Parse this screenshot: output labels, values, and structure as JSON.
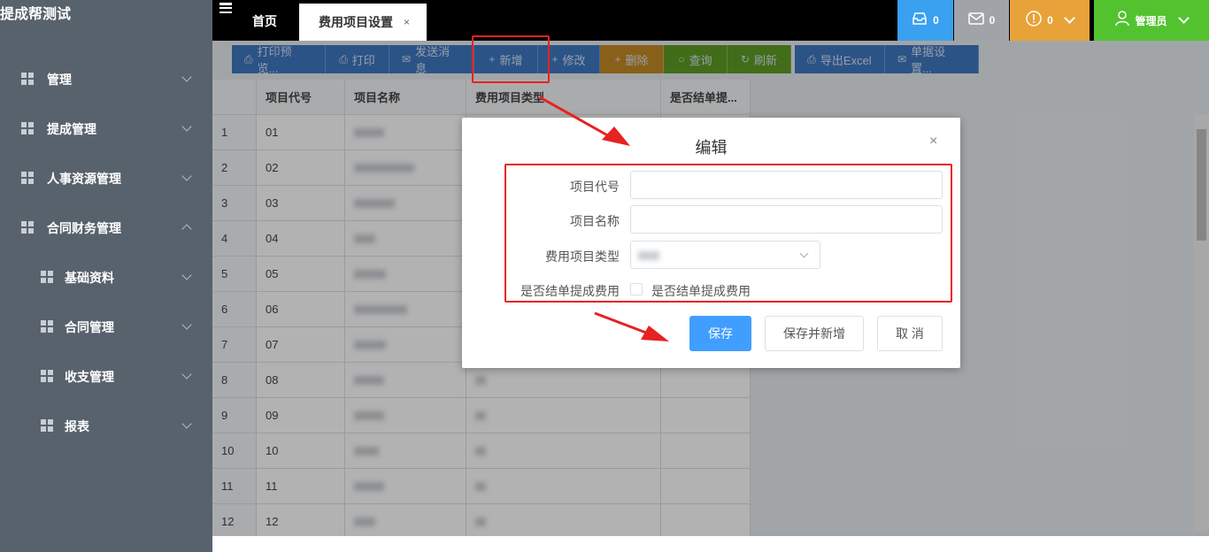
{
  "app": {
    "title": "提成帮测试"
  },
  "sidebar": {
    "items": [
      {
        "label": "管理",
        "expanded": false,
        "level": 0
      },
      {
        "label": "提成管理",
        "expanded": false,
        "level": 0
      },
      {
        "label": "人事资源管理",
        "expanded": false,
        "level": 0
      },
      {
        "label": "合同财务管理",
        "expanded": true,
        "level": 0
      },
      {
        "label": "基础资料",
        "expanded": false,
        "level": 1
      },
      {
        "label": "合同管理",
        "expanded": false,
        "level": 1
      },
      {
        "label": "收支管理",
        "expanded": false,
        "level": 1
      },
      {
        "label": "报表",
        "expanded": false,
        "level": 1
      }
    ]
  },
  "topbar": {
    "tabs": {
      "home": "首页",
      "active": "费用项目设置",
      "close": "×"
    },
    "inbox_count": "0",
    "mail_count": "0",
    "alert_count": "0",
    "user_label": "管理员",
    "colors": {
      "inbox": "#3aa0f0",
      "mail": "#a0a4a9",
      "alert": "#e8a23a",
      "user": "#52c32f"
    }
  },
  "toolbar": {
    "print_preview": "打印预览...",
    "print": "打印",
    "send_message": "发送消息",
    "add": "新增",
    "modify": "修改",
    "delete": "删除",
    "query": "查询",
    "refresh": "刷新",
    "export_excel": "导出Excel",
    "doc_settings": "单据设置..."
  },
  "table": {
    "columns": [
      "",
      "项目代号",
      "项目名称",
      "费用项目类型",
      "是否结单提..."
    ],
    "rows": [
      {
        "index": "1",
        "code": "01"
      },
      {
        "index": "2",
        "code": "02"
      },
      {
        "index": "3",
        "code": "03"
      },
      {
        "index": "4",
        "code": "04"
      },
      {
        "index": "5",
        "code": "05"
      },
      {
        "index": "6",
        "code": "06"
      },
      {
        "index": "7",
        "code": "07"
      },
      {
        "index": "8",
        "code": "08"
      },
      {
        "index": "9",
        "code": "09"
      },
      {
        "index": "10",
        "code": "10"
      },
      {
        "index": "11",
        "code": "11"
      },
      {
        "index": "12",
        "code": "12"
      }
    ]
  },
  "dialog": {
    "title": "编辑",
    "close": "×",
    "fields": {
      "code_label": "项目代号",
      "code_value": "",
      "name_label": "项目名称",
      "name_value": "",
      "type_label": "费用项目类型",
      "settle_label": "是否结单提成费用",
      "settle_checkbox_label": "是否结单提成费用"
    },
    "buttons": {
      "save": "保存",
      "save_and_new": "保存并新增",
      "cancel": "取 消"
    }
  }
}
